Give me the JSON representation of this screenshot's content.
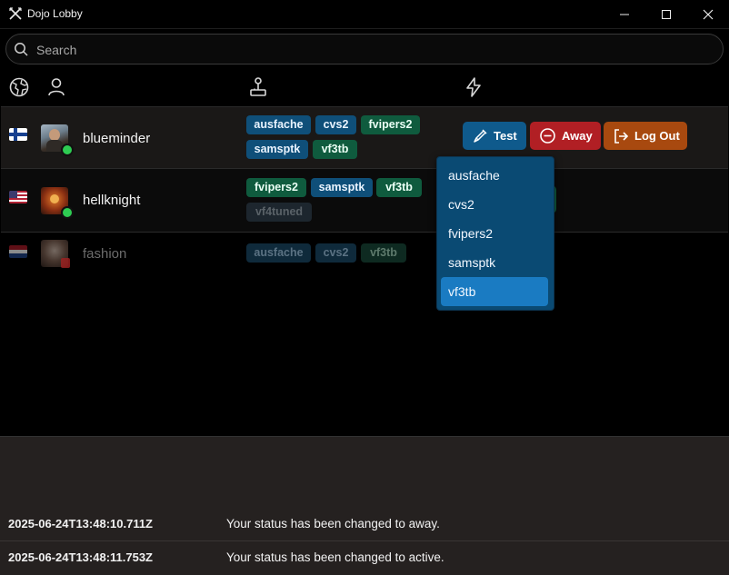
{
  "window": {
    "title": "Dojo Lobby",
    "controls": [
      "minimize",
      "maximize",
      "close"
    ]
  },
  "search": {
    "placeholder": "Search",
    "value": ""
  },
  "header": {
    "icons": [
      "globe-icon",
      "user-icon",
      "joystick-icon",
      "lightning-icon"
    ]
  },
  "players": [
    {
      "flag": "Finland",
      "name": "blueminder",
      "online": true,
      "games": [
        {
          "label": "ausfache",
          "color": "blue"
        },
        {
          "label": "cvs2",
          "color": "blue"
        },
        {
          "label": "fvipers2",
          "color": "green"
        },
        {
          "label": "samsptk",
          "color": "blue"
        },
        {
          "label": "vf3tb",
          "color": "green"
        }
      ],
      "actions": {
        "test": "Test",
        "away": "Away",
        "logout": "Log Out"
      }
    },
    {
      "flag": "United States",
      "name": "hellknight",
      "online": true,
      "games": [
        {
          "label": "fvipers2",
          "color": "green"
        },
        {
          "label": "samsptk",
          "color": "blue"
        },
        {
          "label": "vf3tb",
          "color": "green"
        },
        {
          "label": "vf4tuned",
          "color": "dim"
        }
      ]
    },
    {
      "flag": "Netherlands",
      "name": "fashion",
      "online": false,
      "games": [
        {
          "label": "ausfache",
          "color": "dim"
        },
        {
          "label": "cvs2",
          "color": "dim"
        },
        {
          "label": "vf3tb",
          "color": "dim"
        }
      ]
    }
  ],
  "dropdown": {
    "items": [
      "ausfache",
      "cvs2",
      "fvipers2",
      "samsptk",
      "vf3tb"
    ],
    "selected": "vf3tb"
  },
  "log": [
    {
      "timestamp": "2025-06-24T13:48:10.711Z",
      "message": "Your status has been changed to away."
    },
    {
      "timestamp": "2025-06-24T13:48:11.753Z",
      "message": "Your status has been changed to active."
    }
  ],
  "colors": {
    "tag_blue": "#0f4f79",
    "tag_green": "#0f5b3e",
    "test_button": "#0f5a8c",
    "away_button": "#b11f24",
    "logout_button": "#a8490f",
    "online_dot": "#2ecc52",
    "dropdown_selected": "#1a7bc2"
  }
}
